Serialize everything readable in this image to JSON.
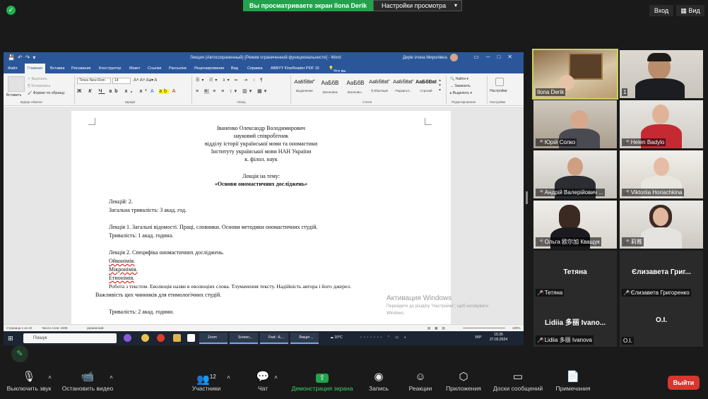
{
  "top": {
    "share_banner": "Вы просматриваете экран Ilona Derik",
    "view_settings": "Настройки просмотра",
    "enter": "Вход",
    "view": "Вид"
  },
  "word": {
    "title": "Лекция  (Автосохраненный) [Режим ограниченной функциональности] - Word",
    "user": "Дерік Ілона Миролівна",
    "tabs": [
      "Файл",
      "Главная",
      "Вставка",
      "Рисование",
      "Конструктор",
      "Макет",
      "Ссылки",
      "Рассылки",
      "Рецензирование",
      "Вид",
      "Справка",
      "ABBYY FineReader PDF 15",
      "Что вы хотите сделать?"
    ],
    "ribbon": {
      "paste": "Вставить",
      "cut": "Вырезать",
      "copy": "Копировать",
      "format_painter": "Формат по образцу",
      "clipboard": "Буфер обмена",
      "font_name": "Times New Rom",
      "font_size": "14",
      "font_group": "Шрифт",
      "paragraph_group": "Абзац",
      "styles_group": "Стили",
      "editing_group": "Редактирование",
      "settings_group": "Настройки",
      "find": "Найти",
      "replace": "Заменить",
      "select": "Выделить",
      "settings": "Настройки",
      "styles": [
        {
          "sample": "АаБбВвГ",
          "name": "Выделение"
        },
        {
          "sample": "АаБбВ",
          "name": "Заголовок"
        },
        {
          "sample": "АаБбВ",
          "name": "Заголово..."
        },
        {
          "sample": "АаБбВвГ",
          "name": "¶ Обычный"
        },
        {
          "sample": "АаБбВвГ",
          "name": "Подзагол..."
        },
        {
          "sample": "АаБбВвI",
          "name": "Строгий"
        },
        {
          "sample": "АаБбВв",
          "name": "Название"
        }
      ]
    },
    "status": {
      "page": "Страница 1 из 10",
      "words": "Число слов: 1508",
      "lang": "украинский",
      "zoom": "100%"
    }
  },
  "document": {
    "header_lines": [
      "Іваненко Олександр Володимирович",
      "науковий співробітник",
      "відділу історії української мови та ономастики",
      "Інституту української мови НАН України",
      "к. філол. наук"
    ],
    "lecture_on": "Лекція на тему:",
    "lecture_title": "«Основи ономастичних досліджень»",
    "lines": [
      "Лекцій: 2.",
      "Загальна тривалість: 3 акад. год.",
      "Лекція 1. Загальні відомості. Праці, словники. Основи методики ономастичних студій.",
      "Тривалість: 1 акад. година.",
      "Лекція 2. Специфіка ономастичних досліджень.",
      "Ойконімія.",
      "Мікронімія.",
      "Етнонімія.",
      "Робота з текстом. Еволюція назви в еволюціях слова. Тлумачення тексту. Надійність автора і його джерел.",
      "Важливість цих чинників для етимологічних студій.",
      "Тривалість: 2 акад. години."
    ]
  },
  "activation": {
    "title": "Активация Windows",
    "line1": "Перейдите до розділу \"Настройки\", щоб активувати",
    "line2": "Windows."
  },
  "taskbar": {
    "search": "Пошук",
    "apps": [
      "Zoom",
      "Screen...",
      "Fwd: -IL...",
      "Лекція ..."
    ],
    "weather": "10°C",
    "lang": "УКР",
    "time": "15:26",
    "date": "27.03.2024"
  },
  "participants": [
    {
      "name": "Ilona Derik",
      "muted": false
    },
    {
      "name": "1",
      "muted": false
    },
    {
      "name": "Юрій Сопко",
      "muted": true
    },
    {
      "name": "Helen Badylo",
      "muted": true
    },
    {
      "name": "Андрій Валерійович ...",
      "muted": true
    },
    {
      "name": "Viktoriia Horiachkina",
      "muted": true
    },
    {
      "name": "Ольга 欧尔加 Кващук",
      "muted": true
    },
    {
      "name": "莉雅",
      "muted": true
    },
    {
      "name": "Тетяна",
      "big": "Тетяна",
      "muted": true
    },
    {
      "name": "Єлизавета Григоренко",
      "big": "Єлизавета Григ...",
      "muted": true
    },
    {
      "name": "Lidiia 多丽 Ivanova",
      "big": "Lidiia 多丽 Ivano...",
      "muted": true
    },
    {
      "name": "О.І.",
      "big": "О.І.",
      "muted": false
    }
  ],
  "bottom": {
    "mute": "Выключить звук",
    "video": "Остановить видео",
    "participants": "Участники",
    "participants_count": "12",
    "chat": "Чат",
    "share": "Демонстрация экрана",
    "record": "Запись",
    "reactions": "Реакции",
    "apps": "Приложения",
    "whiteboards": "Доски сообщений",
    "notes": "Примечания",
    "leave": "Выйти"
  },
  "colors": {
    "zoom_green": "#23a24d",
    "word_blue": "#2b579a",
    "leave_red": "#d9362f",
    "speaker_highlight": "#cbd35a"
  }
}
